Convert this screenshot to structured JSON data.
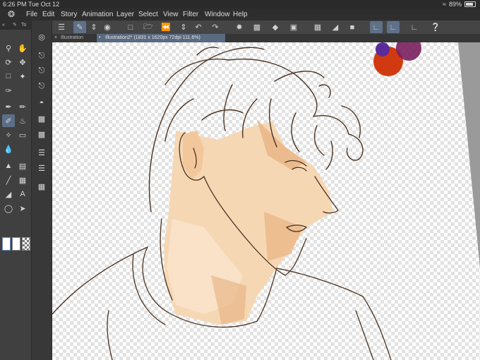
{
  "status": {
    "time": "6:26 PM",
    "date": "Tue Oct 12",
    "battery": "89%"
  },
  "menu": [
    "File",
    "Edit",
    "Story",
    "Animation",
    "Layer",
    "Select",
    "View",
    "Filter",
    "Window",
    "Help"
  ],
  "tabs": [
    {
      "label": "Illustration"
    },
    {
      "label": "Illustration2* (1831 x 1620px 72dpi 111.6%)"
    }
  ],
  "tool_panel": {
    "header_label": "To"
  },
  "icons": {
    "command_bar": [
      "menu-icon",
      "new-layer-icon",
      "stepper-icon",
      "layer-target-icon",
      "new-canvas-icon",
      "open-icon",
      "save-icon",
      "export-icon",
      "undo-icon",
      "redo-icon",
      "loading-icon",
      "copy-icon",
      "fill-icon",
      "transform-icon",
      "clear-icon",
      "fill-layer-icon",
      "invert-icon",
      "stabilize-icon",
      "brush-setting-icon",
      "pen-setting-icon",
      "ruler-icon",
      "help-icon"
    ],
    "tools": [
      "pen-icon",
      "zoom-icon",
      "hand-icon",
      "rotate-icon",
      "move-icon",
      "marquee-icon",
      "magic-wand-icon",
      "eyedropper-icon",
      "pen-tool-icon",
      "pencil-icon",
      "brush-icon",
      "airbrush-icon",
      "decoration-icon",
      "eraser-icon",
      "blend-icon",
      "fill-icon",
      "gradient-icon",
      "line-icon",
      "frame-icon",
      "figure-icon",
      "text-icon",
      "lasso-icon",
      "operation-icon"
    ]
  },
  "colors": {
    "accent": "#5c6f88",
    "skin": "#f6d7b4",
    "line": "#4a3322"
  }
}
